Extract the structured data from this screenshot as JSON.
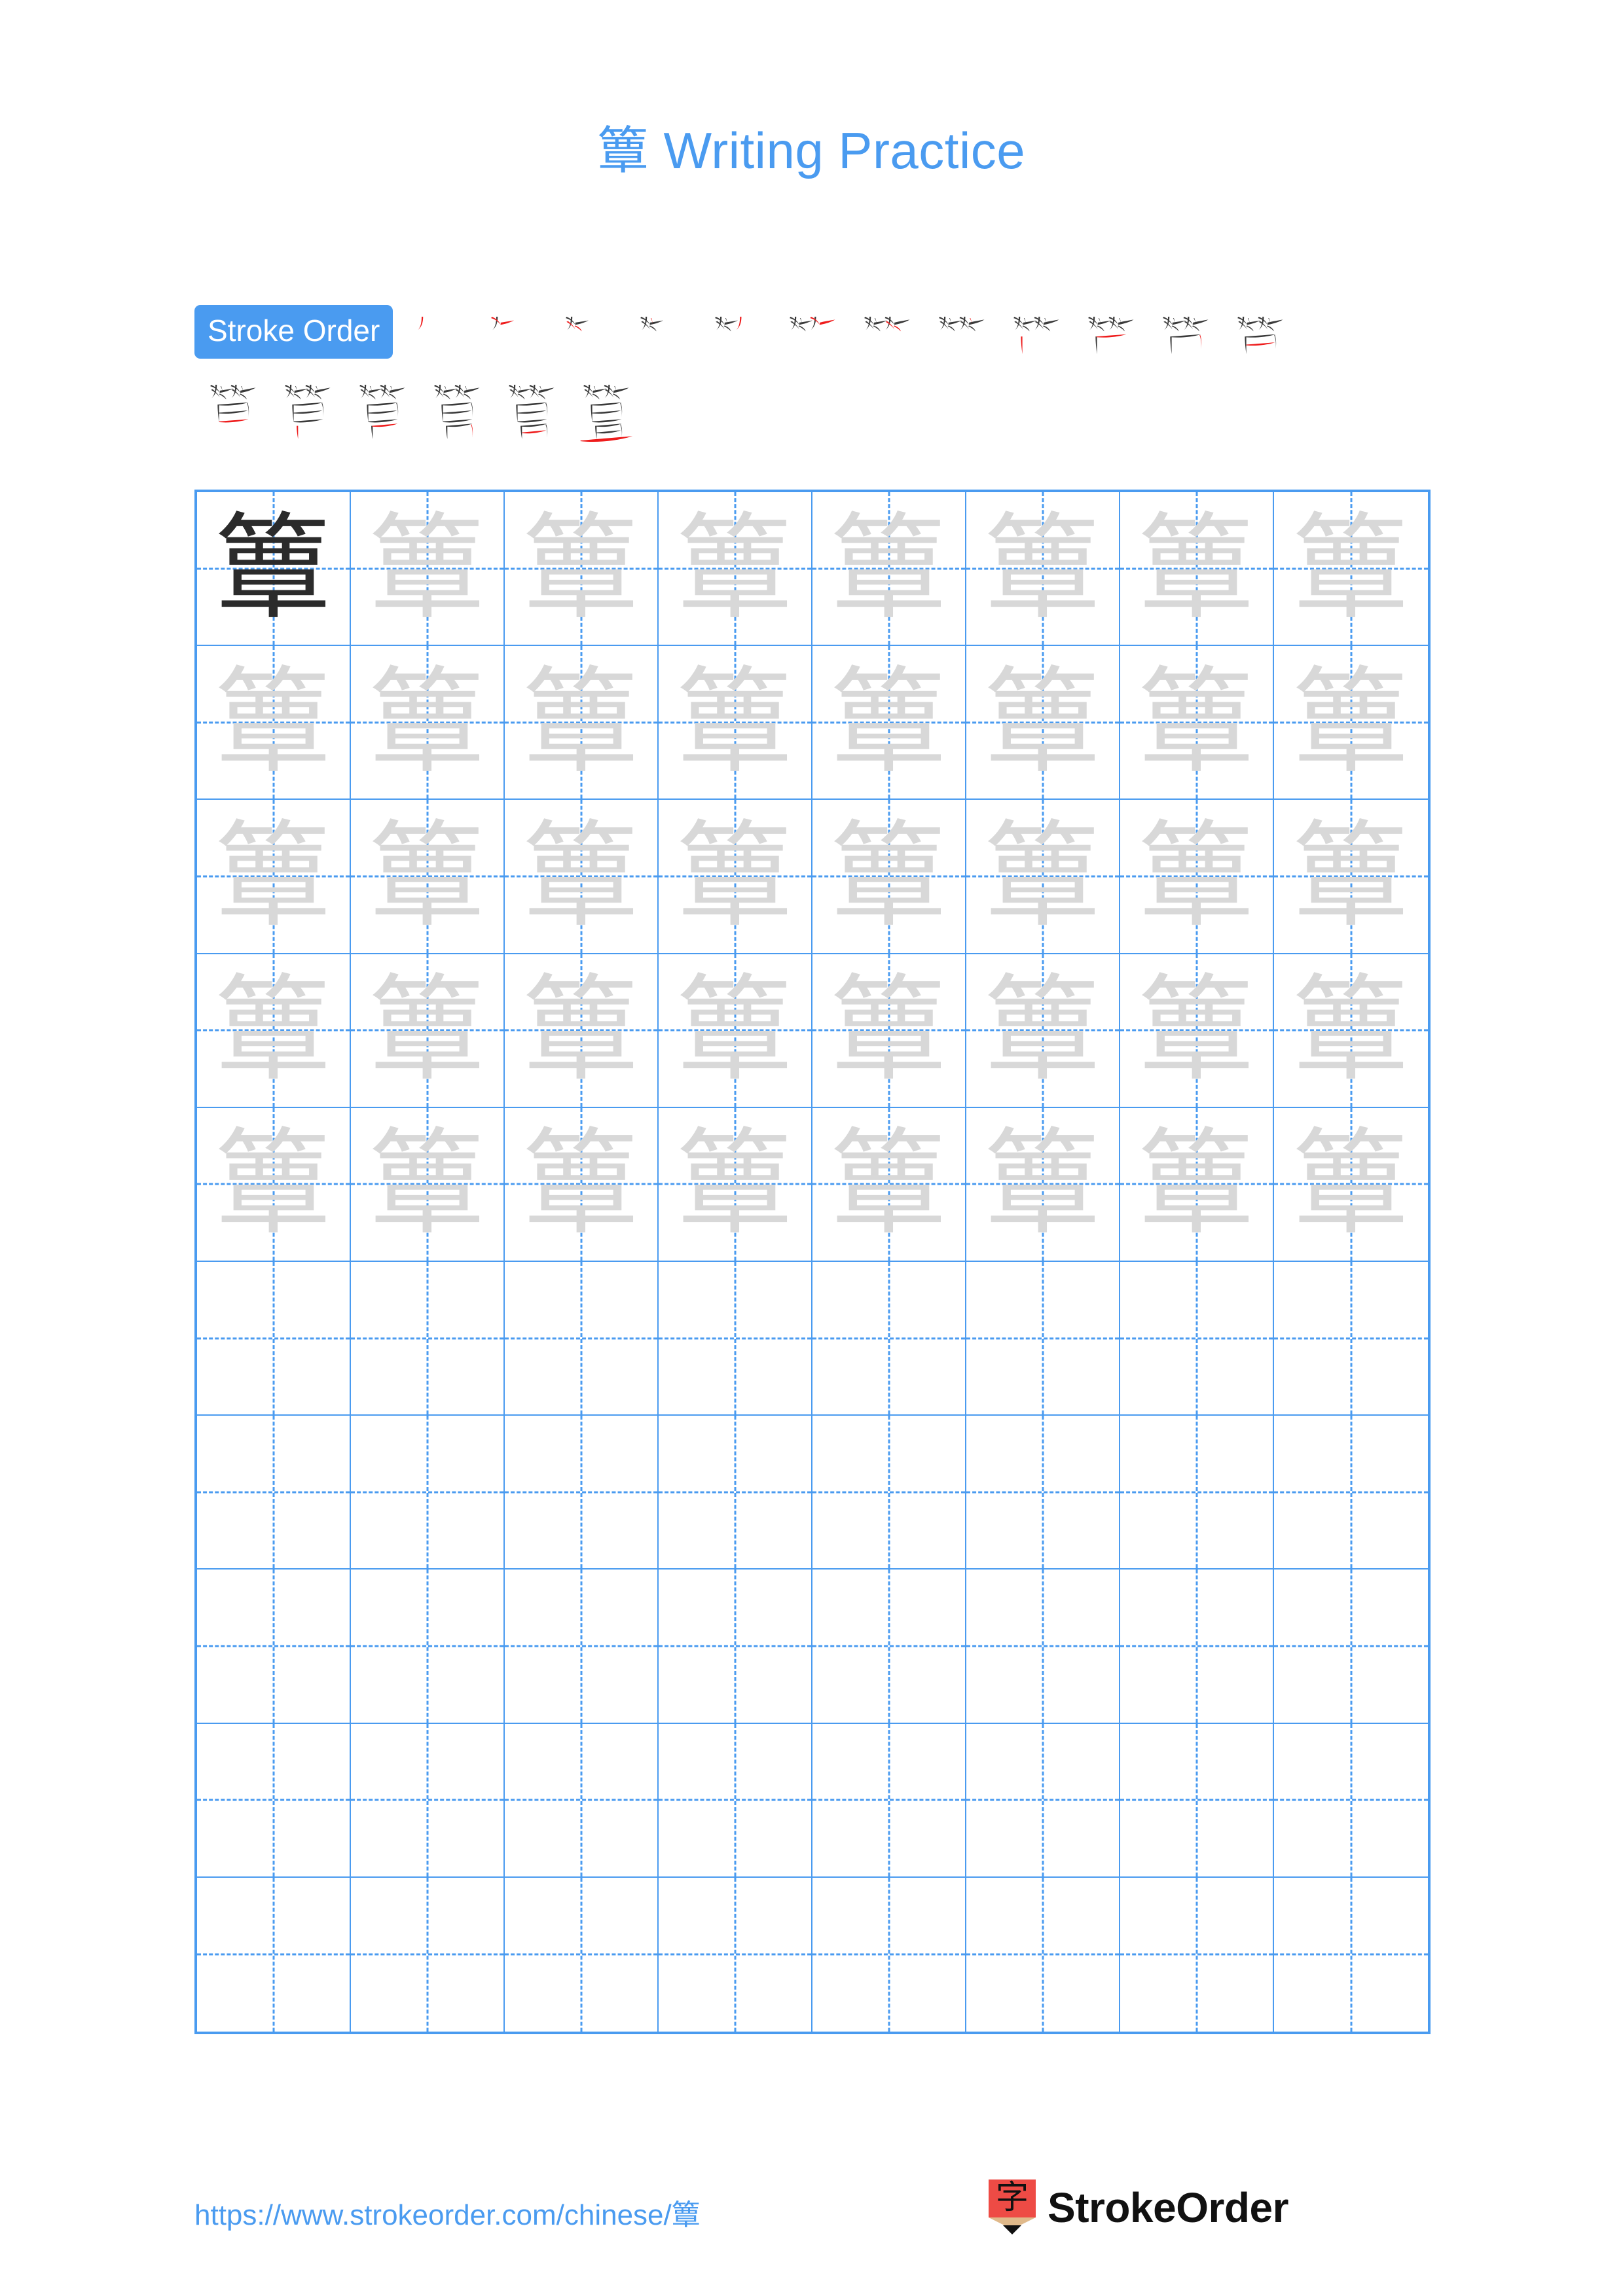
{
  "page": {
    "character": "簟",
    "title_suffix": " Writing Practice",
    "title_full": "簟 Writing Practice",
    "background_color": "#ffffff",
    "accent_color": "#4a9bf0",
    "grid_line_color": "#4a9bf0",
    "model_char_color": "#2b2b2b",
    "trace_char_color": "#d8d8d8",
    "new_stroke_color": "#ee1c1c",
    "prior_stroke_color": "#3a3a3a"
  },
  "stroke_order": {
    "badge_label": "Stroke Order",
    "total_strokes": 18,
    "row1_count": 12,
    "row2_count": 6,
    "steps": [
      {
        "index": 1,
        "glyph": "丿"
      },
      {
        "index": 2,
        "glyph": "𠂉"
      },
      {
        "index": 3,
        "glyph": "𫂁"
      },
      {
        "index": 4,
        "glyph": "𬺰"
      },
      {
        "index": 5,
        "glyph": "𭕄"
      },
      {
        "index": 6,
        "glyph": "𫝀"
      },
      {
        "index": 7,
        "glyph": "𫠠"
      },
      {
        "index": 8,
        "glyph": "𫠡"
      },
      {
        "index": 9,
        "glyph": "𫠢"
      },
      {
        "index": 10,
        "glyph": "𫠣"
      },
      {
        "index": 11,
        "glyph": "𫠤"
      },
      {
        "index": 12,
        "glyph": "笛"
      },
      {
        "index": 13,
        "glyph": "箄"
      },
      {
        "index": 14,
        "glyph": "箅"
      },
      {
        "index": 15,
        "glyph": "箆"
      },
      {
        "index": 16,
        "glyph": "箇"
      },
      {
        "index": 17,
        "glyph": "簟"
      },
      {
        "index": 18,
        "glyph": "簟"
      }
    ]
  },
  "practice_grid": {
    "columns": 8,
    "rows": 10,
    "filled_rows": 5,
    "empty_rows": 5,
    "model_cell": {
      "row": 1,
      "column": 1,
      "character": "簟"
    },
    "trace_character": "簟"
  },
  "footer": {
    "url": "https://www.strokeorder.com/chinese/簟",
    "logo_char": "字",
    "logo_text": "StrokeOrder"
  }
}
